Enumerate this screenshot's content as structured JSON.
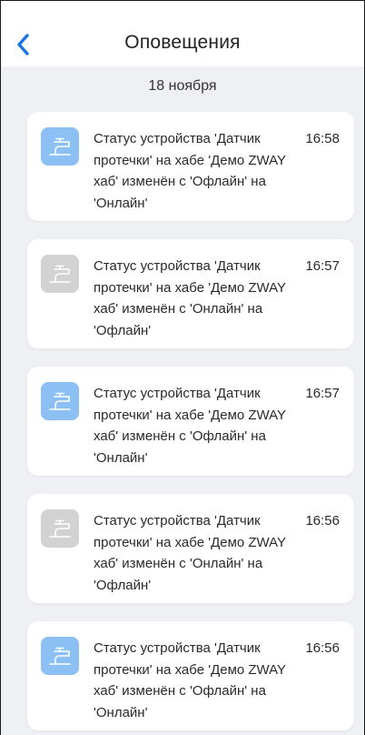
{
  "header": {
    "title": "Оповещения",
    "back_icon": "chevron-left-icon",
    "accent_color": "#1976e0"
  },
  "date_label": "18 ноября",
  "colors": {
    "online_icon_bg": "#8cc0f5",
    "offline_icon_bg": "#d2d2d2",
    "background": "#eef0f4"
  },
  "notifications": [
    {
      "icon": "water-tap-icon",
      "status": "online",
      "message": "Статус устройства 'Датчик протечки' на хабе 'Демо ZWAY хаб' изменён с 'Офлайн' на 'Онлайн'",
      "time": "16:58"
    },
    {
      "icon": "water-tap-icon",
      "status": "offline",
      "message": "Статус устройства 'Датчик протечки' на хабе 'Демо ZWAY хаб' изменён с 'Онлайн' на 'Офлайн'",
      "time": "16:57"
    },
    {
      "icon": "water-tap-icon",
      "status": "online",
      "message": "Статус устройства 'Датчик протечки' на хабе 'Демо ZWAY хаб' изменён с 'Офлайн' на 'Онлайн'",
      "time": "16:57"
    },
    {
      "icon": "water-tap-icon",
      "status": "offline",
      "message": "Статус устройства 'Датчик протечки' на хабе 'Демо ZWAY хаб' изменён с 'Онлайн' на 'Офлайн'",
      "time": "16:56"
    },
    {
      "icon": "water-tap-icon",
      "status": "online",
      "message": "Статус устройства 'Датчик протечки' на хабе 'Демо ZWAY хаб' изменён с 'Офлайн' на 'Онлайн'",
      "time": "16:56"
    }
  ]
}
